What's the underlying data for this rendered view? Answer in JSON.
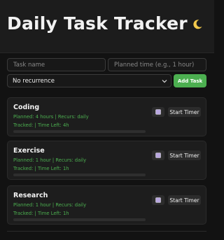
{
  "app": {
    "title": "Daily Task Tracker",
    "theme_icon": "moon-icon"
  },
  "form": {
    "task_name_placeholder": "Task name",
    "planned_time_placeholder": "Planned time (e.g., 1 hour)",
    "recurrence_selected": "No recurrence",
    "add_label": "Add Task"
  },
  "tasks": [
    {
      "name": "Coding",
      "planned": "Planned: 4 hours | Recurs: daily",
      "tracked": "Tracked: | Time Left: 4h",
      "progress": 0,
      "start_label": "Start Timer",
      "edit_icon": "square-icon"
    },
    {
      "name": "Exercise",
      "planned": "Planned: 1 hour | Recurs: daily",
      "tracked": "Tracked: | Time Left: 1h",
      "progress": 0,
      "start_label": "Start Timer",
      "edit_icon": "square-icon"
    },
    {
      "name": "Research",
      "planned": "Planned: 1 hour | Recurs: daily",
      "tracked": "Tracked: | Time Left: 1h",
      "progress": 0,
      "start_label": "Start Timer",
      "edit_icon": "square-icon"
    }
  ],
  "colors": {
    "accent": "#4caf50",
    "background": "#121212",
    "card": "#1d1d1d"
  }
}
